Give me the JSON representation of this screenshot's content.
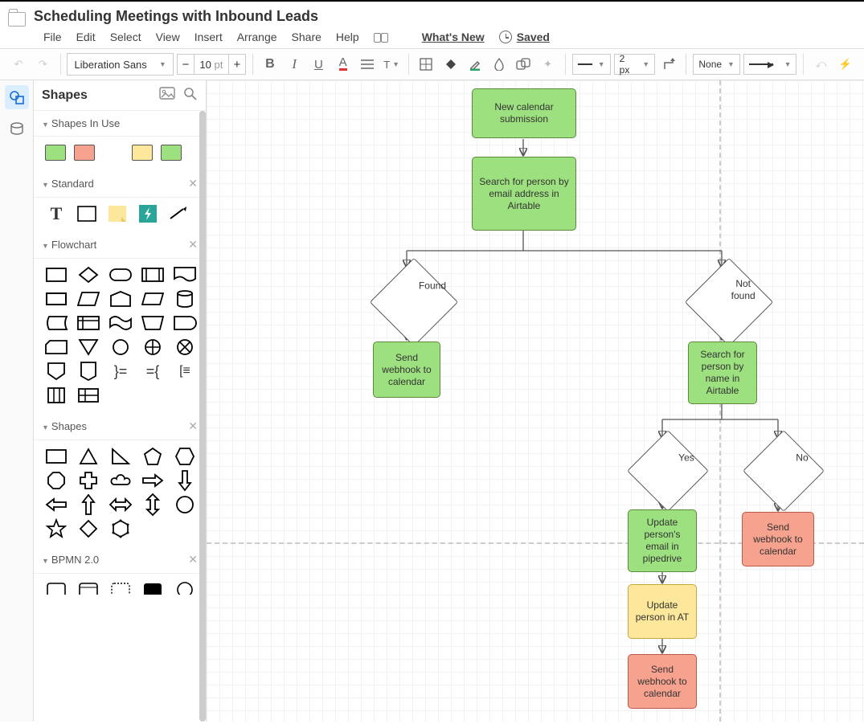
{
  "doc_title": "Scheduling Meetings with Inbound Leads",
  "menu": {
    "file": "File",
    "edit": "Edit",
    "select": "Select",
    "view": "View",
    "insert": "Insert",
    "arrange": "Arrange",
    "share": "Share",
    "help": "Help",
    "whatsnew": "What's New",
    "saved": "Saved"
  },
  "toolbar": {
    "font": "Liberation Sans",
    "size": "10",
    "size_unit": "pt",
    "stroke_width": "2 px",
    "end_fill": "None"
  },
  "sidebar": {
    "title": "Shapes",
    "sections": {
      "in_use": "Shapes In Use",
      "standard": "Standard",
      "flowchart": "Flowchart",
      "shapes": "Shapes",
      "bpmn": "BPMN 2.0"
    }
  },
  "nodes": {
    "n1": "New calendar submission",
    "n2": "Search for person by email address in Airtable",
    "d_found": "Found",
    "d_notfound": "Not\nfound",
    "n3": "Send webhook to calendar",
    "n4": "Search for person by name in Airtable",
    "d_yes": "Yes",
    "d_no": "No",
    "n5": "Update person's email in pipedrive",
    "n6": "Update person in AT",
    "n7": "Send webhook to calendar",
    "n8": "Send webhook to calendar"
  }
}
